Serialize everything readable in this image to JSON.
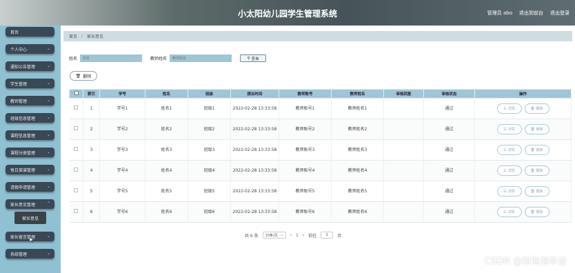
{
  "header": {
    "title": "小太阳幼儿园学生管理系统",
    "role": "管理员 abo",
    "exit_backend": "退出到前台",
    "logout": "退出登录"
  },
  "sidebar": {
    "items": [
      {
        "label": "首页"
      },
      {
        "label": "个人中心"
      },
      {
        "label": "通知公告管理"
      },
      {
        "label": "学生管理"
      },
      {
        "label": "教师管理"
      },
      {
        "label": "班级信息管理"
      },
      {
        "label": "课程信息管理"
      },
      {
        "label": "课程分类管理"
      },
      {
        "label": "每日菜谱管理"
      },
      {
        "label": "请假申请管理"
      },
      {
        "label": "家长意见管理"
      },
      {
        "label": "家长留言管理"
      },
      {
        "label": "系统管理"
      }
    ],
    "submenu_label": "家长意见"
  },
  "breadcrumb": {
    "home": "首页",
    "current": "家长意见"
  },
  "search": {
    "field1_label": "姓名",
    "field1_placeholder": "姓名",
    "field2_label": "教师姓名",
    "field2_placeholder": "教师姓名",
    "button": "查询"
  },
  "toolbar": {
    "delete": "删除"
  },
  "table": {
    "headers": [
      "索引",
      "学号",
      "姓名",
      "班级",
      "提出时间",
      "教师账号",
      "教师姓名",
      "审核回复",
      "审核状态",
      "操作"
    ],
    "rows": [
      {
        "index": "1",
        "student_no": "学号1",
        "name": "姓名1",
        "class": "班级1",
        "time": "2022-02-28 13:33:58",
        "teacher_no": "教师账号1",
        "teacher_name": "教师姓名1",
        "reply": "",
        "status": "通过"
      },
      {
        "index": "2",
        "student_no": "学号2",
        "name": "姓名2",
        "class": "班级2",
        "time": "2022-02-28 13:33:58",
        "teacher_no": "教师账号2",
        "teacher_name": "教师姓名2",
        "reply": "",
        "status": "通过"
      },
      {
        "index": "3",
        "student_no": "学号3",
        "name": "姓名3",
        "class": "班级3",
        "time": "2022-02-28 13:33:58",
        "teacher_no": "教师账号3",
        "teacher_name": "教师姓名3",
        "reply": "",
        "status": "通过"
      },
      {
        "index": "4",
        "student_no": "学号4",
        "name": "姓名4",
        "class": "班级4",
        "time": "2022-02-28 13:33:58",
        "teacher_no": "教师账号4",
        "teacher_name": "教师姓名4",
        "reply": "",
        "status": "通过"
      },
      {
        "index": "5",
        "student_no": "学号5",
        "name": "姓名5",
        "class": "班级5",
        "time": "2022-02-28 13:33:58",
        "teacher_no": "教师账号5",
        "teacher_name": "教师姓名5",
        "reply": "",
        "status": "通过"
      },
      {
        "index": "6",
        "student_no": "学号6",
        "name": "姓名6",
        "class": "班级6",
        "time": "2022-02-28 13:33:58",
        "teacher_no": "教师账号6",
        "teacher_name": "教师姓名6",
        "reply": "",
        "status": "通过"
      }
    ],
    "detail_label": "详情",
    "delete_label": "删除"
  },
  "pagination": {
    "total": "共 6 条",
    "page_size": "10条/页",
    "prev": "‹",
    "current": "1",
    "next": "›",
    "goto_label": "前往",
    "goto_value": "1",
    "page_suffix": "页"
  },
  "watermark": "CSDN @粉泡泡毕设"
}
